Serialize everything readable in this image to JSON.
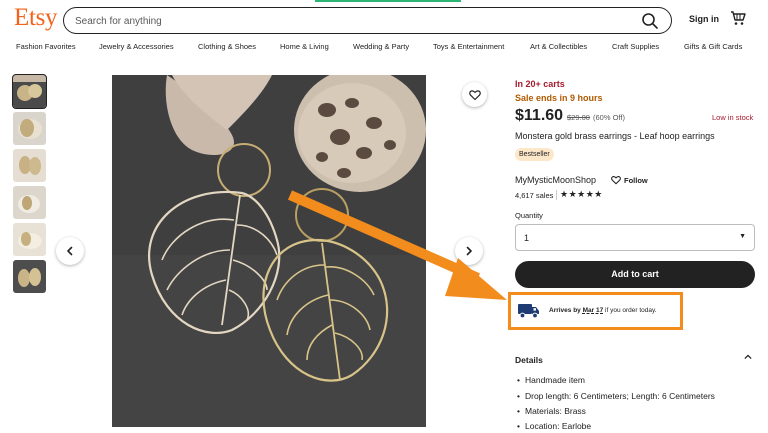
{
  "header": {
    "logo": "Etsy",
    "search_placeholder": "Search for anything",
    "sign_in": "Sign in"
  },
  "nav": {
    "items": [
      "Fashion Favorites",
      "Jewelry & Accessories",
      "Clothing & Shoes",
      "Home & Living",
      "Wedding & Party",
      "Toys & Entertainment",
      "Art & Collectibles",
      "Craft Supplies",
      "Gifts & Gift Cards"
    ]
  },
  "product": {
    "in_carts": "In 20+ carts",
    "sale_ends": "Sale ends in 9 hours",
    "price": "$11.60",
    "original_price": "$29.00",
    "discount": "(60% Off)",
    "stock": "Low in stock",
    "title": "Monstera gold brass earrings - Leaf hoop earrings",
    "badge": "Bestseller",
    "shop_name": "MyMysticMoonShop",
    "follow": "Follow",
    "sales": "4,617 sales",
    "stars": "★★★★★",
    "quantity_label": "Quantity",
    "quantity_value": "1",
    "add_to_cart": "Add to cart",
    "arrives_prefix": "Arrives by",
    "arrives_date": "Mar 17",
    "arrives_suffix": "if you order today.",
    "details_heading": "Details",
    "details": [
      "Handmade item",
      "Drop length: 6 Centimeters; Length: 6 Centimeters",
      "Materials: Brass",
      "Location: Earlobe"
    ]
  },
  "colors": {
    "brand": "#f1641e",
    "annotation": "#f28c1d",
    "alert": "#a61a2e",
    "sale": "#b05a00",
    "badge_bg": "#fde7c9"
  }
}
